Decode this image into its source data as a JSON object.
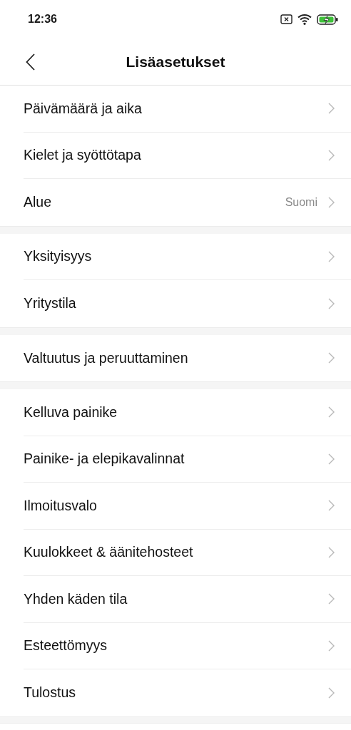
{
  "status_bar": {
    "time": "12:36"
  },
  "header": {
    "title": "Lisäasetukset"
  },
  "groups": [
    {
      "items": [
        {
          "label": "Päivämäärä ja aika"
        },
        {
          "label": "Kielet ja syöttötapa"
        },
        {
          "label": "Alue",
          "value": "Suomi"
        }
      ]
    },
    {
      "items": [
        {
          "label": "Yksityisyys"
        },
        {
          "label": "Yritystila"
        }
      ]
    },
    {
      "items": [
        {
          "label": "Valtuutus ja peruuttaminen"
        }
      ]
    },
    {
      "items": [
        {
          "label": "Kelluva painike"
        },
        {
          "label": "Painike- ja elepikavalinnat"
        },
        {
          "label": "Ilmoitusvalo"
        },
        {
          "label": "Kuulokkeet & äänitehosteet"
        },
        {
          "label": "Yhden käden tila"
        },
        {
          "label": "Esteettömyys"
        },
        {
          "label": "Tulostus"
        }
      ]
    }
  ]
}
